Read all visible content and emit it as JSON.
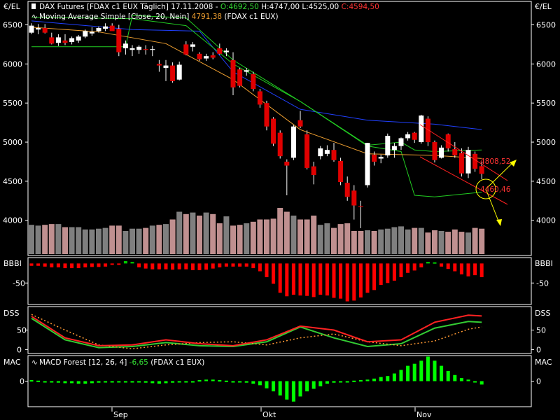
{
  "header": {
    "main_title": "DAX Futures [FDAX c1 EUX  Täglich] 17.11.2008 - ",
    "o_label": "O:4692,50",
    "h_label": "H:4747,00",
    "l_label": "L:4525,00",
    "c_label": "C:4594,50",
    "ma_title": "Moving Average Simple [Close, 20, Nein]",
    "ma_value": "4791,38",
    "ma_suffix": "(FDAX c1 EUX)",
    "macd_title": "MACD Forest [12, 26, 4]",
    "macd_value": "-6,65",
    "macd_suffix": "(FDAX c1 EUX)"
  },
  "panels": {
    "price_unit_left": "€/EL",
    "price_unit_right": "€/EL",
    "bbbi_left": "BBBI",
    "bbbi_right": "BBBI",
    "bbbi_tick": "-50",
    "dss_left": "DSS",
    "dss_right": "DSS",
    "dss_ticks": [
      "50",
      "0"
    ],
    "mac_left": "MAC",
    "mac_right": "MAC",
    "mac_tick": "0"
  },
  "colors": {
    "up": "#ffffff",
    "down": "#e00000",
    "bull_vol": "#7f7f7f",
    "bear_vol": "#c09090",
    "bb_band": "#22cc22",
    "ma20": "#f0a030",
    "ma_long": "#2040ff",
    "channel": "#ff2020",
    "arrow": "#ffff00",
    "dss_k": "#33cc33",
    "dss_d": "#ff2222",
    "dss_sig": "#ff9933",
    "macd": "#00ff00",
    "bbbi_neg": "#ff0000",
    "bbbi_pos": "#00cc00"
  },
  "annotations": {
    "channel_upper": "4808,52",
    "channel_lower": "4460,46"
  },
  "x_axis": {
    "month_labels": [
      "Sep",
      "Okt",
      "Nov"
    ]
  },
  "chart_data": [
    {
      "type": "candlestick",
      "title": "DAX Futures [FDAX c1 EUX  Täglich] 17.11.2008",
      "ylabel": "€/EL",
      "ylim": [
        3550,
        6800
      ],
      "yticks": [
        4000,
        4500,
        5000,
        5500,
        6000,
        6500
      ],
      "ohlc": [
        {
          "o": 6400,
          "h": 6520,
          "l": 6380,
          "c": 6490
        },
        {
          "o": 6440,
          "h": 6510,
          "l": 6380,
          "c": 6460
        },
        {
          "o": 6460,
          "h": 6510,
          "l": 6390,
          "c": 6400
        },
        {
          "o": 6340,
          "h": 6400,
          "l": 6250,
          "c": 6260
        },
        {
          "o": 6270,
          "h": 6380,
          "l": 6230,
          "c": 6340
        },
        {
          "o": 6300,
          "h": 6380,
          "l": 6240,
          "c": 6270
        },
        {
          "o": 6280,
          "h": 6350,
          "l": 6250,
          "c": 6330
        },
        {
          "o": 6300,
          "h": 6370,
          "l": 6270,
          "c": 6350
        },
        {
          "o": 6350,
          "h": 6440,
          "l": 6330,
          "c": 6420
        },
        {
          "o": 6390,
          "h": 6470,
          "l": 6360,
          "c": 6410
        },
        {
          "o": 6420,
          "h": 6480,
          "l": 6400,
          "c": 6460
        },
        {
          "o": 6450,
          "h": 6520,
          "l": 6420,
          "c": 6480
        },
        {
          "o": 6490,
          "h": 6520,
          "l": 6460,
          "c": 6420
        },
        {
          "o": 6450,
          "h": 6500,
          "l": 6100,
          "c": 6150
        },
        {
          "o": 6200,
          "h": 6300,
          "l": 6120,
          "c": 6260
        },
        {
          "o": 6180,
          "h": 6240,
          "l": 6100,
          "c": 6200
        },
        {
          "o": 6180,
          "h": 6240,
          "l": 6130,
          "c": 6220
        },
        {
          "o": 6190,
          "h": 6240,
          "l": 6120,
          "c": 6180
        },
        {
          "o": 6180,
          "h": 6230,
          "l": 6100,
          "c": 6190
        },
        {
          "o": 6000,
          "h": 6050,
          "l": 5900,
          "c": 5980
        },
        {
          "o": 5950,
          "h": 6050,
          "l": 5780,
          "c": 5980
        },
        {
          "o": 5980,
          "h": 6020,
          "l": 5760,
          "c": 5780
        },
        {
          "o": 5800,
          "h": 6030,
          "l": 5790,
          "c": 5990
        },
        {
          "o": 6250,
          "h": 6290,
          "l": 6110,
          "c": 6120
        },
        {
          "o": 6220,
          "h": 6280,
          "l": 6160,
          "c": 6250
        },
        {
          "o": 6130,
          "h": 6150,
          "l": 6040,
          "c": 6060
        },
        {
          "o": 6070,
          "h": 6130,
          "l": 6040,
          "c": 6100
        },
        {
          "o": 6110,
          "h": 6150,
          "l": 6060,
          "c": 6080
        },
        {
          "o": 6200,
          "h": 6260,
          "l": 6120,
          "c": 6130
        },
        {
          "o": 6150,
          "h": 6200,
          "l": 6100,
          "c": 6170
        },
        {
          "o": 6050,
          "h": 6150,
          "l": 5600,
          "c": 5700
        },
        {
          "o": 5930,
          "h": 5950,
          "l": 5700,
          "c": 5720
        },
        {
          "o": 5900,
          "h": 5950,
          "l": 5850,
          "c": 5920
        },
        {
          "o": 5870,
          "h": 5900,
          "l": 5650,
          "c": 5680
        },
        {
          "o": 5650,
          "h": 5680,
          "l": 5440,
          "c": 5480
        },
        {
          "o": 5500,
          "h": 5530,
          "l": 5150,
          "c": 5200
        },
        {
          "o": 5300,
          "h": 5320,
          "l": 4950,
          "c": 4980
        },
        {
          "o": 5120,
          "h": 5150,
          "l": 4790,
          "c": 4820
        },
        {
          "o": 4750,
          "h": 4780,
          "l": 4320,
          "c": 4700
        },
        {
          "o": 4800,
          "h": 5220,
          "l": 4770,
          "c": 5200
        },
        {
          "o": 5280,
          "h": 5400,
          "l": 5180,
          "c": 5200
        },
        {
          "o": 5100,
          "h": 5150,
          "l": 4650,
          "c": 4670
        },
        {
          "o": 4690,
          "h": 4750,
          "l": 4460,
          "c": 4580
        },
        {
          "o": 4820,
          "h": 4950,
          "l": 4780,
          "c": 4920
        },
        {
          "o": 4850,
          "h": 4960,
          "l": 4820,
          "c": 4900
        },
        {
          "o": 4900,
          "h": 4990,
          "l": 4750,
          "c": 4770
        },
        {
          "o": 4760,
          "h": 4800,
          "l": 4450,
          "c": 4490
        },
        {
          "o": 4480,
          "h": 4560,
          "l": 4250,
          "c": 4300
        },
        {
          "o": 4380,
          "h": 4450,
          "l": 4010,
          "c": 4190
        },
        {
          "o": 4180,
          "h": 4250,
          "l": 3900,
          "c": 4170
        },
        {
          "o": 4450,
          "h": 4990,
          "l": 4420,
          "c": 4990
        },
        {
          "o": 4840,
          "h": 4880,
          "l": 4700,
          "c": 4750
        },
        {
          "o": 4790,
          "h": 4840,
          "l": 4730,
          "c": 4810
        },
        {
          "o": 4830,
          "h": 5110,
          "l": 4800,
          "c": 5080
        },
        {
          "o": 4900,
          "h": 4990,
          "l": 4800,
          "c": 4950
        },
        {
          "o": 4950,
          "h": 5060,
          "l": 4900,
          "c": 5050
        },
        {
          "o": 5050,
          "h": 5130,
          "l": 5020,
          "c": 5100
        },
        {
          "o": 5120,
          "h": 5130,
          "l": 4990,
          "c": 5030
        },
        {
          "o": 5000,
          "h": 5350,
          "l": 4980,
          "c": 5340
        },
        {
          "o": 5300,
          "h": 5330,
          "l": 4950,
          "c": 5000
        },
        {
          "o": 5000,
          "h": 5020,
          "l": 4740,
          "c": 4770
        },
        {
          "o": 4800,
          "h": 4960,
          "l": 4790,
          "c": 4930
        },
        {
          "o": 5100,
          "h": 5110,
          "l": 4880,
          "c": 4920
        },
        {
          "o": 4910,
          "h": 5000,
          "l": 4800,
          "c": 4830
        },
        {
          "o": 4860,
          "h": 4920,
          "l": 4560,
          "c": 4600
        },
        {
          "o": 4600,
          "h": 4940,
          "l": 4540,
          "c": 4900
        },
        {
          "o": 4850,
          "h": 4880,
          "l": 4620,
          "c": 4660
        },
        {
          "o": 4692.5,
          "h": 4747,
          "l": 4525,
          "c": 4594.5
        }
      ],
      "volume_bars": [
        38,
        37,
        38,
        39,
        39,
        35,
        35,
        35,
        32,
        32,
        33,
        34,
        37,
        37,
        30,
        33,
        33,
        34,
        37,
        38,
        39,
        45,
        55,
        52,
        54,
        50,
        54,
        52,
        40,
        49,
        37,
        38,
        40,
        42,
        45,
        45,
        46,
        60,
        55,
        50,
        45,
        45,
        50,
        38,
        40,
        34,
        39,
        40,
        30,
        30,
        31,
        30,
        32,
        33,
        35,
        36,
        32,
        34,
        34,
        28,
        31,
        30,
        29,
        32,
        29,
        28,
        34,
        33
      ]
    },
    {
      "type": "line",
      "title": "Moving Average Simple [Close, 20, Nein]",
      "series": [
        {
          "name": "Moving Average Simple [Close, 20, Nein]",
          "x": [
            0,
            10,
            20,
            30,
            40,
            50,
            60,
            67
          ],
          "values": [
            6470,
            6410,
            6260,
            5800,
            5160,
            4850,
            4830,
            4791.38
          ]
        }
      ],
      "note_series": [
        {
          "x": [
            0,
            15,
            25,
            30,
            40,
            50,
            60,
            67
          ],
          "values": [
            6550,
            6440,
            6420,
            5900,
            5420,
            5280,
            5230,
            5160
          ]
        },
        {
          "x": [
            0,
            14,
            15,
            23,
            30,
            40,
            50,
            55,
            57,
            60,
            67
          ],
          "values": [
            6220,
            6220,
            6620,
            6590,
            6050,
            5520,
            4950,
            4880,
            4320,
            4300,
            4360
          ]
        },
        {
          "x": [
            0,
            14,
            15,
            23,
            30,
            40,
            50,
            55,
            57,
            60,
            67
          ],
          "values": [
            6600,
            6580,
            6580,
            6490,
            6000,
            5520,
            4960,
            5000,
            4900,
            4880,
            4900
          ]
        }
      ]
    },
    {
      "type": "bar",
      "title": "BBBI",
      "ylim": [
        -105,
        15
      ],
      "yticks": [
        -50
      ],
      "values": [
        -6,
        -6,
        -8,
        -10,
        -10,
        -12,
        -12,
        -12,
        -10,
        -9,
        -9,
        -8,
        -3,
        -1,
        6,
        4,
        -10,
        -13,
        -15,
        -15,
        -15,
        -16,
        -15,
        -15,
        -17,
        -17,
        -16,
        -13,
        -10,
        -8,
        -8,
        -8,
        -8,
        -12,
        -20,
        -35,
        -52,
        -75,
        -84,
        -80,
        -82,
        -83,
        -86,
        -80,
        -82,
        -88,
        -90,
        -97,
        -95,
        -87,
        -75,
        -68,
        -55,
        -50,
        -44,
        -35,
        -24,
        -18,
        -10,
        4,
        3,
        -8,
        -14,
        -20,
        -28,
        -33,
        -30,
        -35
      ]
    },
    {
      "type": "line",
      "title": "DSS",
      "ylim": [
        -10,
        110
      ],
      "yticks": [
        50,
        0
      ],
      "series": [
        {
          "x": [
            0,
            5,
            10,
            15,
            20,
            25,
            30,
            35,
            40,
            45,
            50,
            55,
            60,
            65,
            67
          ],
          "values": [
            80,
            25,
            5,
            8,
            18,
            10,
            8,
            20,
            58,
            30,
            8,
            15,
            55,
            72,
            70
          ]
        },
        {
          "x": [
            0,
            5,
            10,
            15,
            20,
            25,
            30,
            35,
            40,
            45,
            50,
            55,
            60,
            65,
            67
          ],
          "values": [
            90,
            50,
            12,
            2,
            12,
            18,
            20,
            12,
            30,
            40,
            20,
            10,
            22,
            52,
            58
          ]
        },
        {
          "x": [
            0,
            5,
            10,
            15,
            20,
            25,
            30,
            35,
            40,
            45,
            50,
            55,
            60,
            65,
            67
          ],
          "values": [
            85,
            30,
            10,
            12,
            25,
            15,
            10,
            25,
            60,
            50,
            20,
            25,
            70,
            88,
            86
          ]
        }
      ]
    },
    {
      "type": "bar",
      "title": "MACD Forest [12, 26, 4]",
      "ylim": [
        -50,
        50
      ],
      "yticks": [
        0
      ],
      "values": [
        2,
        1,
        0,
        -2,
        -3,
        -4,
        -4,
        -5,
        -5,
        -4,
        -3,
        -2,
        -1,
        -1,
        -2,
        -2,
        -2,
        -3,
        -4,
        -5,
        -4,
        -3,
        -2,
        -1,
        0,
        2,
        3,
        3,
        2,
        1,
        0,
        -1,
        -3,
        -5,
        -8,
        -14,
        -20,
        -28,
        -36,
        -40,
        -30,
        -20,
        -15,
        -10,
        -5,
        -3,
        -2,
        0,
        1,
        2,
        3,
        5,
        8,
        10,
        15,
        22,
        30,
        34,
        40,
        48,
        40,
        30,
        20,
        12,
        6,
        3,
        -1,
        -6.65
      ]
    }
  ]
}
